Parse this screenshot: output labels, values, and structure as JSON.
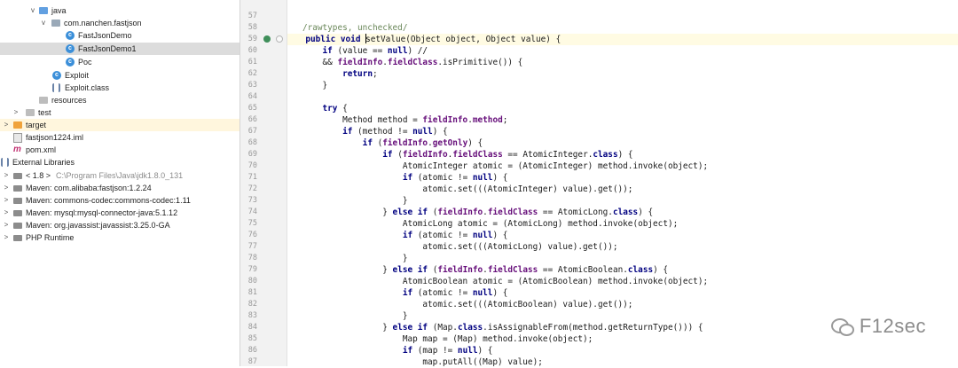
{
  "project_tree": {
    "nodes": [
      {
        "label": "java",
        "icon": "folder-icon",
        "arrow": "v"
      },
      {
        "label": "com.nanchen.fastjson",
        "icon": "package-icon",
        "arrow": "v"
      },
      {
        "label": "FastJsonDemo",
        "icon": "class-icon",
        "arrow": ""
      },
      {
        "label": "FastJsonDemo1",
        "icon": "class-icon",
        "arrow": "",
        "selected": true
      },
      {
        "label": "Poc",
        "icon": "class-icon",
        "arrow": ""
      },
      {
        "label": "Exploit",
        "icon": "class-icon",
        "arrow": ""
      },
      {
        "label": "Exploit.class",
        "icon": "compiled-class-icon",
        "arrow": ""
      },
      {
        "label": "resources",
        "icon": "resources-folder-icon",
        "arrow": ""
      },
      {
        "label": "test",
        "icon": "folder-icon",
        "arrow": ">"
      },
      {
        "label": "target",
        "icon": "excluded-folder-icon",
        "arrow": ">"
      },
      {
        "label": "fastjson1224.iml",
        "icon": "module-file-icon",
        "arrow": ""
      },
      {
        "label": "pom.xml",
        "icon": "maven-icon",
        "arrow": ""
      },
      {
        "label": "External Libraries",
        "icon": "libraries-icon",
        "arrow": "v"
      },
      {
        "label": "< 1.8 >",
        "extra": "C:\\Program Files\\Java\\jdk1.8.0_131",
        "icon": "jdk-icon",
        "arrow": ">"
      },
      {
        "label": "Maven: com.alibaba:fastjson:1.2.24",
        "icon": "library-icon",
        "arrow": ">"
      },
      {
        "label": "Maven: commons-codec:commons-codec:1.11",
        "icon": "library-icon",
        "arrow": ">"
      },
      {
        "label": "Maven: mysql:mysql-connector-java:5.1.12",
        "icon": "library-icon",
        "arrow": ">"
      },
      {
        "label": "Maven: org.javassist:javassist:3.25.0-GA",
        "icon": "library-icon",
        "arrow": ">"
      },
      {
        "label": "PHP Runtime",
        "icon": "library-icon",
        "arrow": ">"
      }
    ]
  },
  "editor": {
    "first_line": 57,
    "current_line": 59,
    "lines": [
      [],
      [
        [
          "c",
          "/rawtypes, unchecked/"
        ]
      ],
      [
        [
          "k",
          "public void "
        ],
        [
          "caret",
          ""
        ],
        [
          "t",
          "setValue(Object object, Object value) {"
        ]
      ],
      [
        [
          "t",
          "    "
        ],
        [
          "k",
          "if "
        ],
        [
          "t",
          "(value == "
        ],
        [
          "k",
          "null"
        ],
        [
          "t",
          ") //"
        ]
      ],
      [
        [
          "t",
          "    && "
        ],
        [
          "f",
          "fieldInfo"
        ],
        [
          "t",
          "."
        ],
        [
          "f",
          "fieldClass"
        ],
        [
          "t",
          ".isPrimitive()) {"
        ]
      ],
      [
        [
          "t",
          "        "
        ],
        [
          "k",
          "return"
        ],
        [
          "t",
          ";"
        ]
      ],
      [
        [
          "t",
          "    }"
        ]
      ],
      [],
      [
        [
          "t",
          "    "
        ],
        [
          "k",
          "try "
        ],
        [
          "t",
          "{"
        ]
      ],
      [
        [
          "t",
          "        Method method = "
        ],
        [
          "f",
          "fieldInfo"
        ],
        [
          "t",
          "."
        ],
        [
          "f",
          "method"
        ],
        [
          "t",
          ";"
        ]
      ],
      [
        [
          "t",
          "        "
        ],
        [
          "k",
          "if "
        ],
        [
          "t",
          "(method != "
        ],
        [
          "k",
          "null"
        ],
        [
          "t",
          ") {"
        ]
      ],
      [
        [
          "t",
          "            "
        ],
        [
          "k",
          "if "
        ],
        [
          "t",
          "("
        ],
        [
          "f",
          "fieldInfo"
        ],
        [
          "t",
          "."
        ],
        [
          "f",
          "getOnly"
        ],
        [
          "t",
          ") {"
        ]
      ],
      [
        [
          "t",
          "                "
        ],
        [
          "k",
          "if "
        ],
        [
          "t",
          "("
        ],
        [
          "f",
          "fieldInfo"
        ],
        [
          "t",
          "."
        ],
        [
          "f",
          "fieldClass"
        ],
        [
          "t",
          " == AtomicInteger."
        ],
        [
          "k",
          "class"
        ],
        [
          "t",
          ") {"
        ]
      ],
      [
        [
          "t",
          "                    AtomicInteger atomic = (AtomicInteger) method.invoke(object);"
        ]
      ],
      [
        [
          "t",
          "                    "
        ],
        [
          "k",
          "if "
        ],
        [
          "t",
          "(atomic != "
        ],
        [
          "k",
          "null"
        ],
        [
          "t",
          ") {"
        ]
      ],
      [
        [
          "t",
          "                        atomic.set(((AtomicInteger) value).get());"
        ]
      ],
      [
        [
          "t",
          "                    }"
        ]
      ],
      [
        [
          "t",
          "                } "
        ],
        [
          "k",
          "else if "
        ],
        [
          "t",
          "("
        ],
        [
          "f",
          "fieldInfo"
        ],
        [
          "t",
          "."
        ],
        [
          "f",
          "fieldClass"
        ],
        [
          "t",
          " == AtomicLong."
        ],
        [
          "k",
          "class"
        ],
        [
          "t",
          ") {"
        ]
      ],
      [
        [
          "t",
          "                    AtomicLong atomic = (AtomicLong) method.invoke(object);"
        ]
      ],
      [
        [
          "t",
          "                    "
        ],
        [
          "k",
          "if "
        ],
        [
          "t",
          "(atomic != "
        ],
        [
          "k",
          "null"
        ],
        [
          "t",
          ") {"
        ]
      ],
      [
        [
          "t",
          "                        atomic.set(((AtomicLong) value).get());"
        ]
      ],
      [
        [
          "t",
          "                    }"
        ]
      ],
      [
        [
          "t",
          "                } "
        ],
        [
          "k",
          "else if "
        ],
        [
          "t",
          "("
        ],
        [
          "f",
          "fieldInfo"
        ],
        [
          "t",
          "."
        ],
        [
          "f",
          "fieldClass"
        ],
        [
          "t",
          " == AtomicBoolean."
        ],
        [
          "k",
          "class"
        ],
        [
          "t",
          ") {"
        ]
      ],
      [
        [
          "t",
          "                    AtomicBoolean atomic = (AtomicBoolean) method.invoke(object);"
        ]
      ],
      [
        [
          "t",
          "                    "
        ],
        [
          "k",
          "if "
        ],
        [
          "t",
          "(atomic != "
        ],
        [
          "k",
          "null"
        ],
        [
          "t",
          ") {"
        ]
      ],
      [
        [
          "t",
          "                        atomic.set(((AtomicBoolean) value).get());"
        ]
      ],
      [
        [
          "t",
          "                    }"
        ]
      ],
      [
        [
          "t",
          "                } "
        ],
        [
          "k",
          "else if "
        ],
        [
          "t",
          "(Map."
        ],
        [
          "k",
          "class"
        ],
        [
          "t",
          ".isAssignableFrom(method.getReturnType())) {"
        ]
      ],
      [
        [
          "t",
          "                    Map map = (Map) method.invoke(object);"
        ]
      ],
      [
        [
          "t",
          "                    "
        ],
        [
          "k",
          "if "
        ],
        [
          "t",
          "(map != "
        ],
        [
          "k",
          "null"
        ],
        [
          "t",
          ") {"
        ]
      ],
      [
        [
          "t",
          "                        map.putAll((Map) value);"
        ]
      ]
    ]
  },
  "watermark": {
    "text": "F12sec",
    "icon": "wechat-icon"
  },
  "colors": {
    "keyword": "#000080",
    "field": "#660e7a",
    "comment": "#6a8759",
    "selection": "#dcdcdc",
    "current_line": "#fffbe3"
  }
}
